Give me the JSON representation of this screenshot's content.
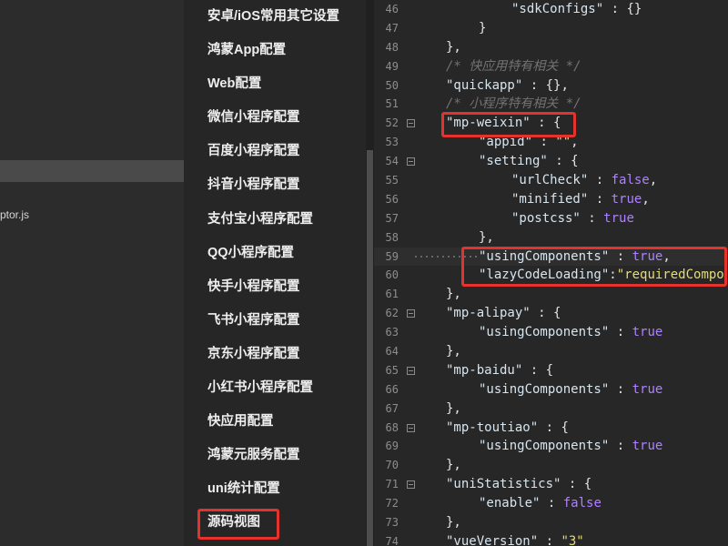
{
  "explorer": {
    "file_label": "ptor.js"
  },
  "settings_menu": {
    "items": [
      "安卓/iOS常用其它设置",
      "鸿蒙App配置",
      "Web配置",
      "微信小程序配置",
      "百度小程序配置",
      "抖音小程序配置",
      "支付宝小程序配置",
      "QQ小程序配置",
      "快手小程序配置",
      "飞书小程序配置",
      "京东小程序配置",
      "小红书小程序配置",
      "快应用配置",
      "鸿蒙元服务配置",
      "uni统计配置",
      "源码视图"
    ]
  },
  "theme": {
    "key": "#d7e5ef",
    "punct": "#e4e4e4",
    "string": "#e6db74",
    "bool": "#ae81ff",
    "comment": "#727272",
    "box": "#e4332d"
  },
  "editor": {
    "lines": [
      {
        "num": "46",
        "tokens": [
          [
            "indent",
            "\t\t\t"
          ],
          [
            "key",
            "\"sdkConfigs\""
          ],
          [
            "punct",
            " : {}"
          ]
        ]
      },
      {
        "num": "47",
        "tokens": [
          [
            "indent",
            "\t\t"
          ],
          [
            "punct",
            "}"
          ]
        ]
      },
      {
        "num": "48",
        "tokens": [
          [
            "indent",
            "\t"
          ],
          [
            "punct",
            "},"
          ]
        ]
      },
      {
        "num": "49",
        "tokens": [
          [
            "indent",
            "\t"
          ],
          [
            "comment",
            "/* 快应用特有相关 */"
          ]
        ]
      },
      {
        "num": "50",
        "tokens": [
          [
            "indent",
            "\t"
          ],
          [
            "key",
            "\"quickapp\""
          ],
          [
            "punct",
            " : {},"
          ]
        ]
      },
      {
        "num": "51",
        "tokens": [
          [
            "indent",
            "\t"
          ],
          [
            "comment",
            "/* 小程序特有相关 */"
          ]
        ]
      },
      {
        "num": "52",
        "fold": true,
        "tokens": [
          [
            "indent",
            "\t"
          ],
          [
            "key",
            "\"mp-weixin\""
          ],
          [
            "punct",
            " : {"
          ]
        ]
      },
      {
        "num": "53",
        "tokens": [
          [
            "indent",
            "\t\t"
          ],
          [
            "key",
            "\"appid\""
          ],
          [
            "punct",
            " : "
          ],
          [
            "string",
            "\"\""
          ],
          [
            "punct",
            ","
          ]
        ]
      },
      {
        "num": "54",
        "fold": true,
        "tokens": [
          [
            "indent",
            "\t\t"
          ],
          [
            "key",
            "\"setting\""
          ],
          [
            "punct",
            " : {"
          ]
        ]
      },
      {
        "num": "55",
        "tokens": [
          [
            "indent",
            "\t\t\t"
          ],
          [
            "key",
            "\"urlCheck\""
          ],
          [
            "punct",
            " : "
          ],
          [
            "bool",
            "false"
          ],
          [
            "punct",
            ","
          ]
        ]
      },
      {
        "num": "56",
        "tokens": [
          [
            "indent",
            "\t\t\t"
          ],
          [
            "key",
            "\"minified\""
          ],
          [
            "punct",
            " : "
          ],
          [
            "bool",
            "true"
          ],
          [
            "punct",
            ","
          ]
        ]
      },
      {
        "num": "57",
        "tokens": [
          [
            "indent",
            "\t\t\t"
          ],
          [
            "key",
            "\"postcss\""
          ],
          [
            "punct",
            " : "
          ],
          [
            "bool",
            "true"
          ]
        ]
      },
      {
        "num": "58",
        "tokens": [
          [
            "indent",
            "\t\t"
          ],
          [
            "punct",
            "},"
          ]
        ]
      },
      {
        "num": "59",
        "current": true,
        "tokens": [
          [
            "indent",
            "\t\t"
          ],
          [
            "key",
            "\"usingComponents\""
          ],
          [
            "punct",
            " : "
          ],
          [
            "bool",
            "true"
          ],
          [
            "punct",
            ","
          ]
        ]
      },
      {
        "num": "60",
        "tokens": [
          [
            "indent",
            "\t\t"
          ],
          [
            "key",
            "\"lazyCodeLoading\""
          ],
          [
            "punct",
            ":"
          ],
          [
            "string",
            "\"requiredCompo"
          ]
        ]
      },
      {
        "num": "61",
        "tokens": [
          [
            "indent",
            "\t"
          ],
          [
            "punct",
            "},"
          ]
        ]
      },
      {
        "num": "62",
        "fold": true,
        "tokens": [
          [
            "indent",
            "\t"
          ],
          [
            "key",
            "\"mp-alipay\""
          ],
          [
            "punct",
            " : {"
          ]
        ]
      },
      {
        "num": "63",
        "tokens": [
          [
            "indent",
            "\t\t"
          ],
          [
            "key",
            "\"usingComponents\""
          ],
          [
            "punct",
            " : "
          ],
          [
            "bool",
            "true"
          ]
        ]
      },
      {
        "num": "64",
        "tokens": [
          [
            "indent",
            "\t"
          ],
          [
            "punct",
            "},"
          ]
        ]
      },
      {
        "num": "65",
        "fold": true,
        "tokens": [
          [
            "indent",
            "\t"
          ],
          [
            "key",
            "\"mp-baidu\""
          ],
          [
            "punct",
            " : {"
          ]
        ]
      },
      {
        "num": "66",
        "tokens": [
          [
            "indent",
            "\t\t"
          ],
          [
            "key",
            "\"usingComponents\""
          ],
          [
            "punct",
            " : "
          ],
          [
            "bool",
            "true"
          ]
        ]
      },
      {
        "num": "67",
        "tokens": [
          [
            "indent",
            "\t"
          ],
          [
            "punct",
            "},"
          ]
        ]
      },
      {
        "num": "68",
        "fold": true,
        "tokens": [
          [
            "indent",
            "\t"
          ],
          [
            "key",
            "\"mp-toutiao\""
          ],
          [
            "punct",
            " : {"
          ]
        ]
      },
      {
        "num": "69",
        "tokens": [
          [
            "indent",
            "\t\t"
          ],
          [
            "key",
            "\"usingComponents\""
          ],
          [
            "punct",
            " : "
          ],
          [
            "bool",
            "true"
          ]
        ]
      },
      {
        "num": "70",
        "tokens": [
          [
            "indent",
            "\t"
          ],
          [
            "punct",
            "},"
          ]
        ]
      },
      {
        "num": "71",
        "fold": true,
        "tokens": [
          [
            "indent",
            "\t"
          ],
          [
            "key",
            "\"uniStatistics\""
          ],
          [
            "punct",
            " : {"
          ]
        ]
      },
      {
        "num": "72",
        "tokens": [
          [
            "indent",
            "\t\t"
          ],
          [
            "key",
            "\"enable\""
          ],
          [
            "punct",
            " : "
          ],
          [
            "bool",
            "false"
          ]
        ]
      },
      {
        "num": "73",
        "tokens": [
          [
            "indent",
            "\t"
          ],
          [
            "punct",
            "},"
          ]
        ]
      },
      {
        "num": "74",
        "tokens": [
          [
            "indent",
            "\t"
          ],
          [
            "key",
            "\"vueVersion\""
          ],
          [
            "punct",
            " : "
          ],
          [
            "string",
            "\"3\""
          ]
        ]
      }
    ]
  }
}
